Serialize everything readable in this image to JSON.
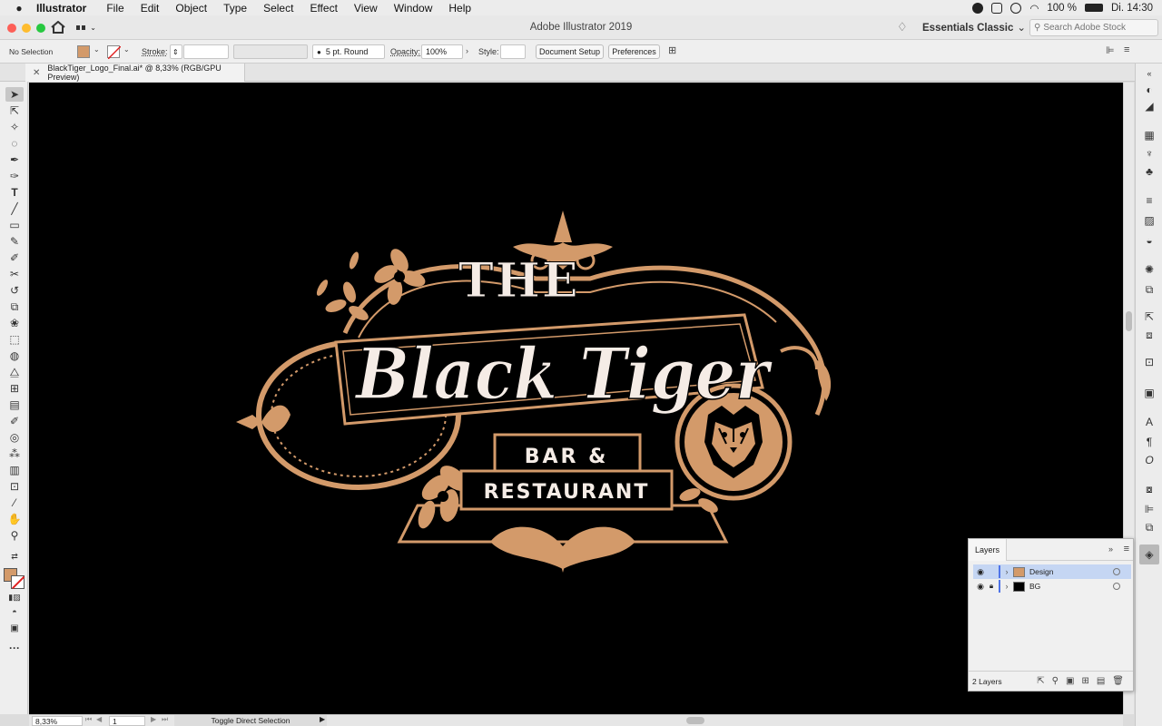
{
  "menubar": {
    "app_name": "Illustrator",
    "items": [
      "File",
      "Edit",
      "Object",
      "Type",
      "Select",
      "Effect",
      "View",
      "Window",
      "Help"
    ],
    "battery": "100 %",
    "clock": "Di. 14:30"
  },
  "titlebar": {
    "title": "Adobe Illustrator 2019",
    "workspace": "Essentials Classic",
    "search_placeholder": "Search Adobe Stock"
  },
  "control_bar": {
    "selection": "No Selection",
    "stroke_label": "Stroke:",
    "brush": "5 pt. Round",
    "opacity_label": "Opacity:",
    "opacity_value": "100%",
    "style_label": "Style:",
    "document_setup": "Document Setup",
    "preferences": "Preferences",
    "fill_color": "#d39a6a"
  },
  "document": {
    "tab_title": "BlackTiger_Logo_Final.ai* @ 8,33% (RGB/GPU Preview)"
  },
  "artwork": {
    "line1": "THE",
    "line2": "Black Tiger",
    "line3": "BAR &",
    "line4": "RESTAURANT",
    "gold": "#d39a6a",
    "cream": "#f5ece6"
  },
  "layers_panel": {
    "tab": "Layers",
    "layers": [
      {
        "name": "Design",
        "selected": true,
        "locked": false
      },
      {
        "name": "BG",
        "selected": false,
        "locked": true
      }
    ],
    "count": "2 Layers"
  },
  "status_bar": {
    "zoom": "8,33%",
    "artboard": "1",
    "status": "Toggle Direct Selection"
  }
}
